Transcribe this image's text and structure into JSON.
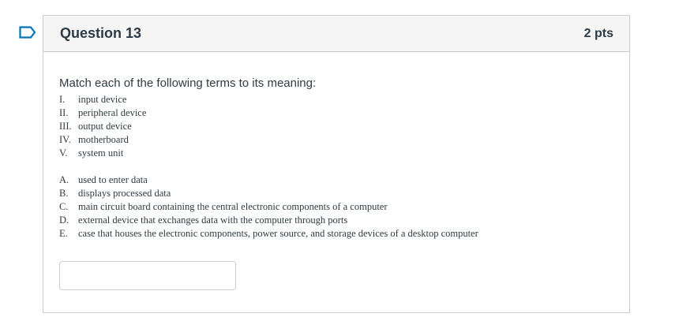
{
  "question": {
    "title": "Question 13",
    "points": "2 pts",
    "prompt": "Match each of the following terms to its meaning:",
    "terms": [
      {
        "marker": "I.",
        "text": "input device"
      },
      {
        "marker": "II.",
        "text": "peripheral device"
      },
      {
        "marker": "III.",
        "text": "output device"
      },
      {
        "marker": "IV.",
        "text": "motherboard"
      },
      {
        "marker": "V.",
        "text": "system unit"
      }
    ],
    "meanings": [
      {
        "marker": "A.",
        "text": "used to enter data"
      },
      {
        "marker": "B.",
        "text": "displays processed data"
      },
      {
        "marker": "C.",
        "text": "main circuit board containing the central electronic components of a computer"
      },
      {
        "marker": "D.",
        "text": "external device that exchanges data with the computer through ports"
      },
      {
        "marker": "E.",
        "text": "case that houses the electronic components, power source, and storage devices of a desktop computer"
      }
    ],
    "answer": {
      "value": "",
      "placeholder": ""
    }
  },
  "colors": {
    "flag": "#0374b5",
    "text": "#2d3b45",
    "header_bg": "#f5f5f5",
    "border": "#c7cdd1"
  },
  "icons": {
    "flag": "bookmark-flag-icon"
  }
}
